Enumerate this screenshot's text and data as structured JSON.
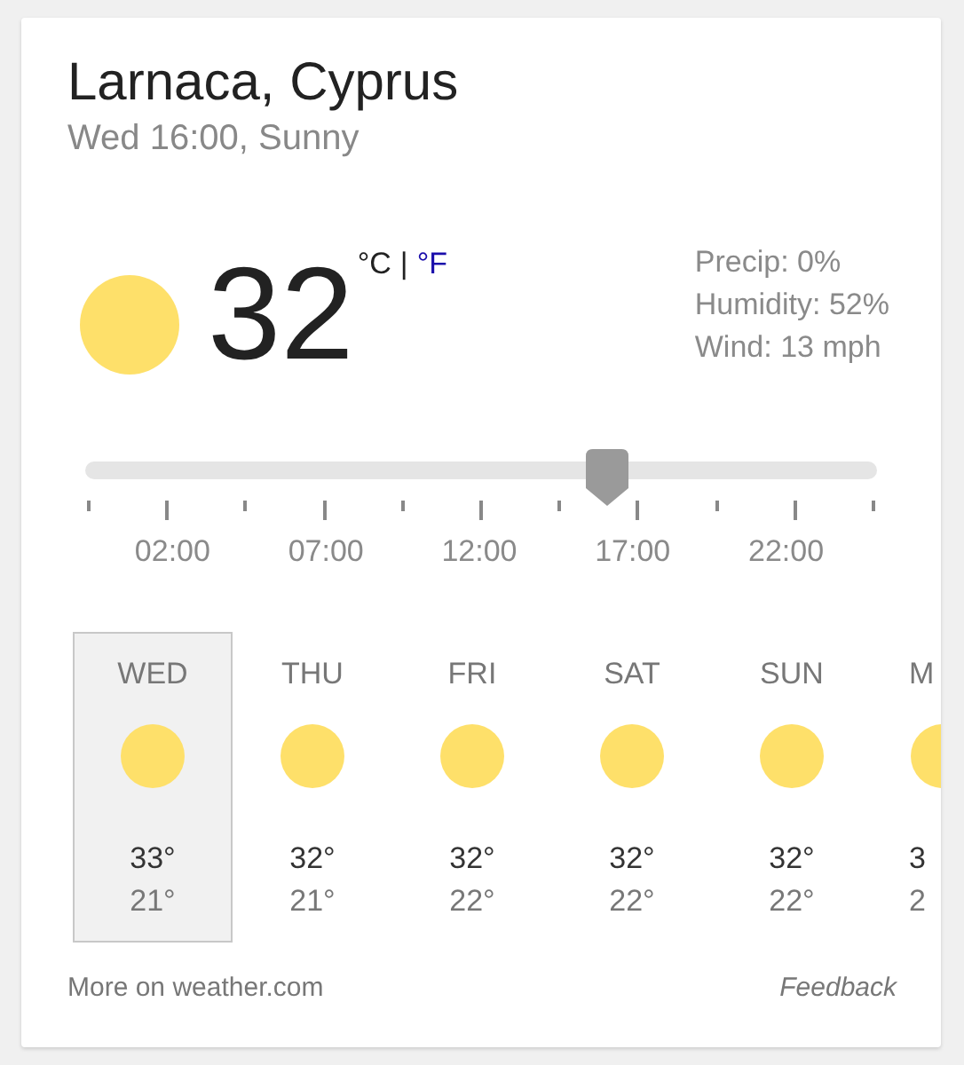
{
  "location": "Larnaca, Cyprus",
  "subtitle": "Wed 16:00, Sunny",
  "current": {
    "temperature": "32",
    "units": [
      {
        "label": "°C",
        "selected": true
      },
      {
        "label": "°F",
        "selected": false
      }
    ],
    "separator": "|"
  },
  "details": [
    "Precip: 0%",
    "Humidity: 52%",
    "Wind: 13 mph"
  ],
  "slider": {
    "level": 0.66,
    "labels": [
      "02:00",
      "07:00",
      "12:00",
      "17:00",
      "22:00"
    ]
  },
  "days": [
    {
      "name": "WED",
      "high": "33°",
      "low": "21°",
      "selected": true
    },
    {
      "name": "THU",
      "high": "32°",
      "low": "21°",
      "selected": false
    },
    {
      "name": "FRI",
      "high": "32°",
      "low": "22°",
      "selected": false
    },
    {
      "name": "SAT",
      "high": "32°",
      "low": "22°",
      "selected": false
    },
    {
      "name": "SUN",
      "high": "32°",
      "low": "22°",
      "selected": false
    },
    {
      "name": "M",
      "high": "3",
      "low": "2",
      "selected": false
    }
  ],
  "footer": {
    "link": "More on weather.com",
    "feedback": "Feedback"
  }
}
